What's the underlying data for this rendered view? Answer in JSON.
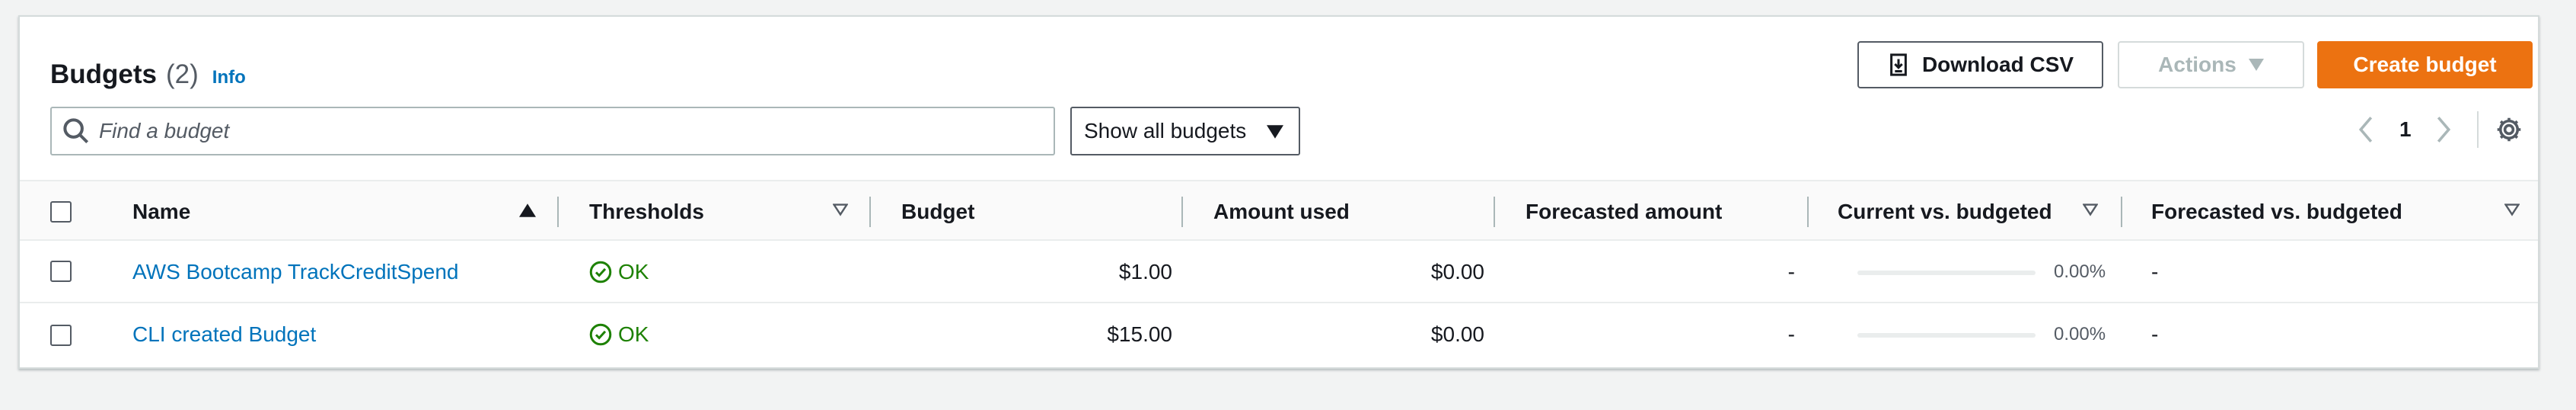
{
  "header": {
    "title": "Budgets",
    "count": "(2)",
    "info": "Info"
  },
  "toolbar": {
    "download_label": "Download CSV",
    "actions_label": "Actions",
    "create_label": "Create budget"
  },
  "search": {
    "placeholder": "Find a budget",
    "value": ""
  },
  "filter": {
    "selected": "Show all budgets"
  },
  "pagination": {
    "current_page": "1"
  },
  "table": {
    "columns": [
      {
        "label": "Name",
        "sort": "ascending"
      },
      {
        "label": "Thresholds",
        "sort": "sortable"
      },
      {
        "label": "Budget"
      },
      {
        "label": "Amount used"
      },
      {
        "label": "Forecasted amount"
      },
      {
        "label": "Current vs. budgeted",
        "sort": "sortable"
      },
      {
        "label": "Forecasted vs. budgeted",
        "sort": "sortable"
      }
    ],
    "rows": [
      {
        "name": "AWS Bootcamp TrackCreditSpend",
        "thresholds": "OK",
        "budget": "$1.00",
        "amount_used": "$0.00",
        "forecasted_amount": "-",
        "current_vs_budgeted": "0.00%",
        "current_vs_budgeted_fraction": 0.0,
        "forecasted_vs_budgeted": "-"
      },
      {
        "name": "CLI created Budget",
        "thresholds": "OK",
        "budget": "$15.00",
        "amount_used": "$0.00",
        "forecasted_amount": "-",
        "current_vs_budgeted": "0.00%",
        "current_vs_budgeted_fraction": 0.0,
        "forecasted_vs_budgeted": "-"
      }
    ]
  },
  "colors": {
    "primary_button": "#ec7211",
    "link": "#0073bb",
    "ok_status": "#1d8102",
    "border": "#d5dbdb"
  },
  "icons": {
    "download": "download-icon",
    "actions_caret": "caret-down-icon",
    "search": "search-icon",
    "filter_caret": "caret-down-icon",
    "prev": "chevron-left-icon",
    "next": "chevron-right-icon",
    "settings": "gear-icon",
    "ok": "check-circle-icon"
  }
}
